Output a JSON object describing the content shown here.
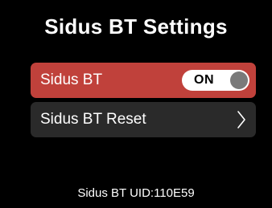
{
  "header": {
    "title": "Sidus BT Settings"
  },
  "settings": {
    "sidus_bt": {
      "label": "Sidus BT",
      "toggle_state": "ON",
      "highlight_color": "#c0413b"
    },
    "sidus_bt_reset": {
      "label": "Sidus BT Reset",
      "icon": "chevron-right-icon"
    }
  },
  "footer": {
    "uid_text": "Sidus BT UID:110E59"
  }
}
